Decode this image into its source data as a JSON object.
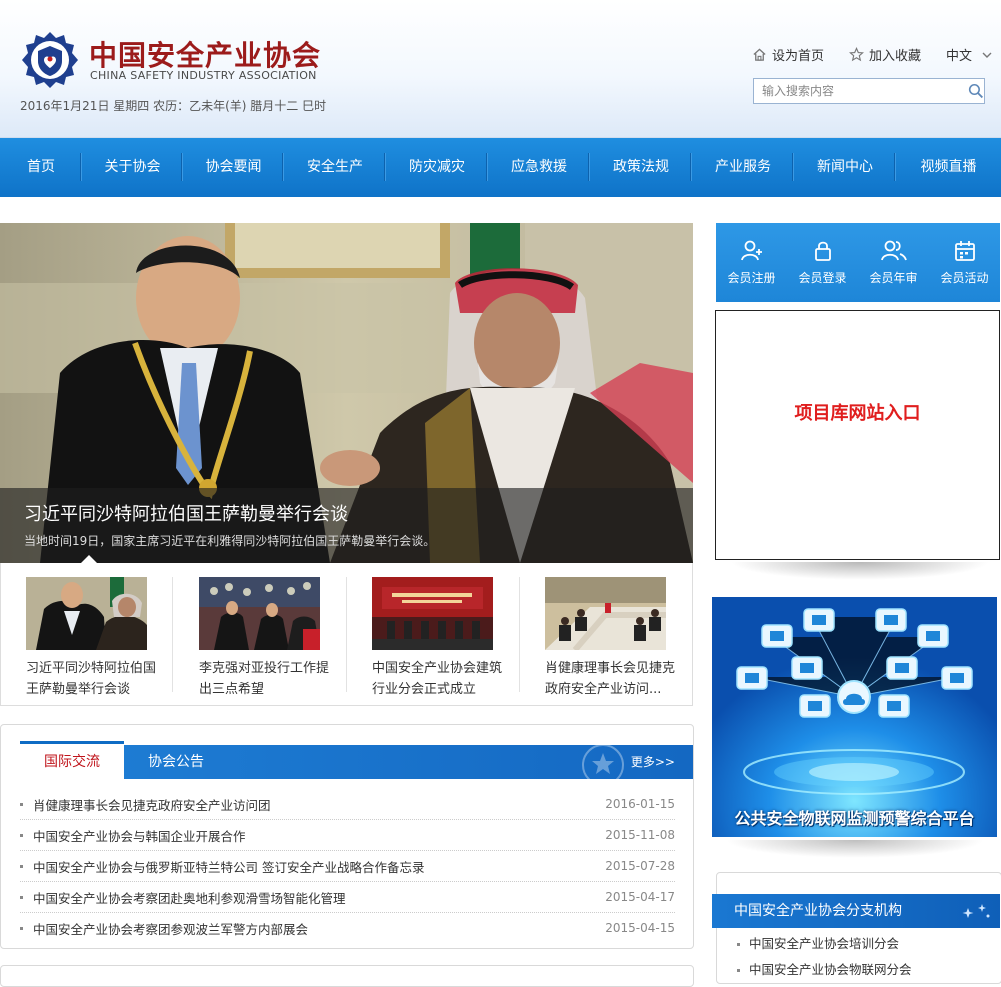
{
  "header": {
    "logo_cn": "中国安全产业协会",
    "logo_en": "CHINA SAFETY INDUSTRY ASSOCIATION",
    "date_line": "2016年1月21日 星期四 农历：乙未年(羊) 腊月十二 巳时",
    "set_home": "设为首页",
    "add_fav": "加入收藏",
    "language": "中文",
    "search_placeholder": "输入搜索内容"
  },
  "nav": [
    "首页",
    "关于协会",
    "协会要闻",
    "安全生产",
    "防灾减灾",
    "应急救援",
    "政策法规",
    "产业服务",
    "新闻中心",
    "视频直播"
  ],
  "slideshow": {
    "title": "习近平同沙特阿拉伯国王萨勒曼举行会谈",
    "subtitle": "当地时间19日，国家主席习近平在利雅得同沙特阿拉伯国王萨勒曼举行会谈。"
  },
  "thumbs": [
    {
      "caption": "习近平同沙特阿拉伯国王萨勒曼举行会谈"
    },
    {
      "caption": "李克强对亚投行工作提出三点希望"
    },
    {
      "caption": "中国安全产业协会建筑行业分会正式成立"
    },
    {
      "caption": "肖健康理事长会见捷克政府安全产业访问..."
    }
  ],
  "news": {
    "tab_active": "国际交流",
    "tab_other": "协会公告",
    "more": "更多>>",
    "items": [
      {
        "title": "肖健康理事长会见捷克政府安全产业访问团",
        "date": "2016-01-15"
      },
      {
        "title": "中国安全产业协会与韩国企业开展合作",
        "date": "2015-11-08"
      },
      {
        "title": "中国安全产业协会与俄罗斯亚特兰特公司 签订安全产业战略合作备忘录",
        "date": "2015-07-28"
      },
      {
        "title": "中国安全产业协会考察团赴奥地利参观滑雪场智能化管理",
        "date": "2015-04-17"
      },
      {
        "title": "中国安全产业协会考察团参观波兰军警方内部展会",
        "date": "2015-04-15"
      }
    ]
  },
  "member": [
    {
      "label": "会员注册",
      "icon": "user-add-icon"
    },
    {
      "label": "会员登录",
      "icon": "lock-icon"
    },
    {
      "label": "会员年审",
      "icon": "users-icon"
    },
    {
      "label": "会员活动",
      "icon": "calendar-icon"
    }
  ],
  "project_entry": "项目库网站入口",
  "iot_banner": "公共安全物联网监测预警综合平台",
  "branch": {
    "title": "中国安全产业协会分支机构",
    "items": [
      "中国安全产业协会培训分会",
      "中国安全产业协会物联网分会"
    ]
  },
  "colors": {
    "nav_blue": "#1477cc",
    "logo_red": "#9c1b1b",
    "accent_red": "#e01e1e"
  }
}
